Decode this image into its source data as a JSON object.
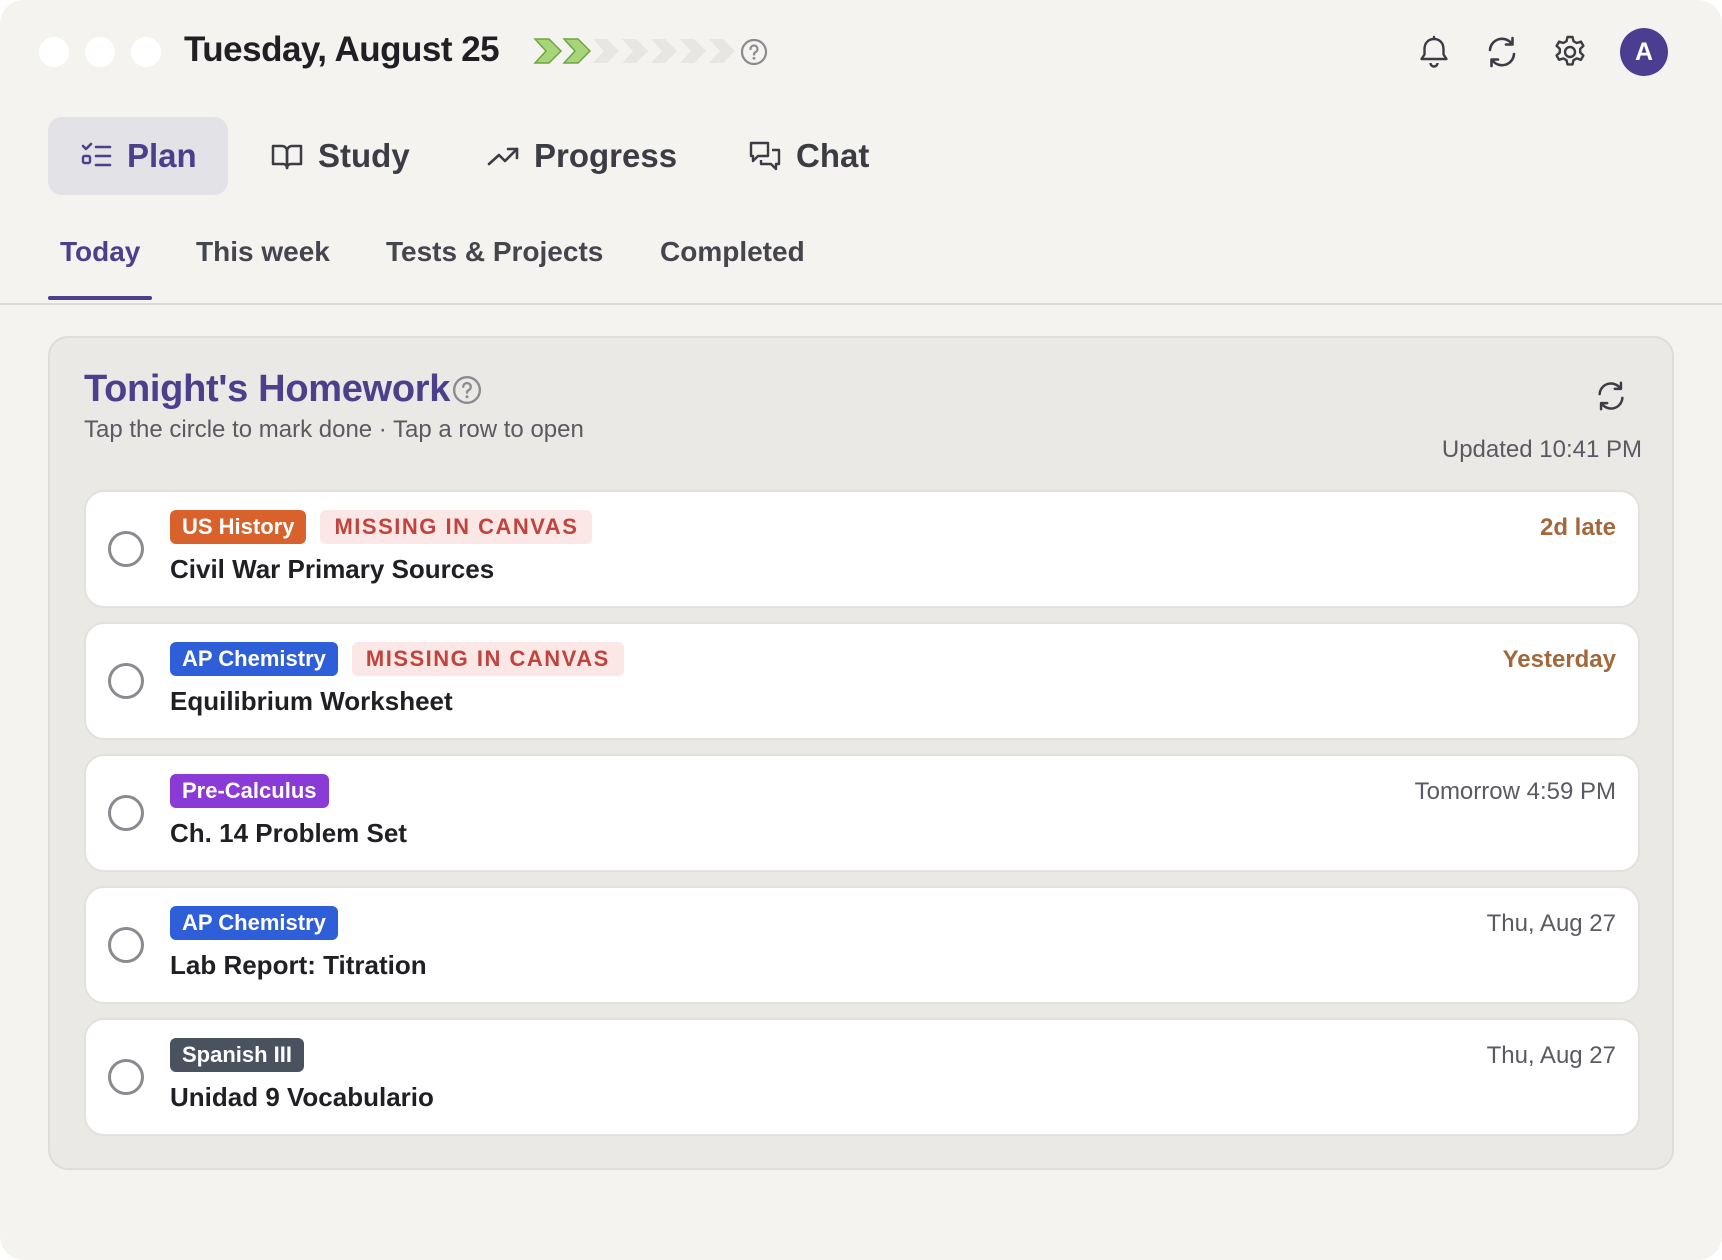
{
  "header": {
    "date": "Tuesday, August 25",
    "streak": {
      "filled": 2,
      "total": 7,
      "filled_color": "#a8d47a",
      "empty_color": "#e7e6e2"
    },
    "help_icon": "question-circle-icon",
    "icons": [
      "bell-icon",
      "refresh-icon",
      "gear-icon"
    ],
    "avatar_initial": "A",
    "avatar_color": "#4b3d8f"
  },
  "nav": {
    "items": [
      {
        "label": "Plan",
        "icon": "checklist-icon",
        "active": true
      },
      {
        "label": "Study",
        "icon": "book-icon",
        "active": false
      },
      {
        "label": "Progress",
        "icon": "trend-up-icon",
        "active": false
      },
      {
        "label": "Chat",
        "icon": "chat-bubbles-icon",
        "active": false
      }
    ]
  },
  "subtabs": {
    "items": [
      {
        "label": "Today",
        "active": true
      },
      {
        "label": "This week",
        "active": false
      },
      {
        "label": "Tests & Projects",
        "active": false
      },
      {
        "label": "Completed",
        "active": false
      }
    ]
  },
  "homework": {
    "title": "Tonight's Homework",
    "subtitle": "Tap the circle to mark done · Tap a row to open",
    "updated": "Updated 10:41 PM",
    "assignments": [
      {
        "subject": "US History",
        "subject_color": "#d9612b",
        "missing": "MISSING IN CANVAS",
        "title": "Civil War Primary Sources",
        "due": "2d late",
        "late": true
      },
      {
        "subject": "AP Chemistry",
        "subject_color": "#2f5fd8",
        "missing": "MISSING IN CANVAS",
        "title": "Equilibrium Worksheet",
        "due": "Yesterday",
        "late": true
      },
      {
        "subject": "Pre-Calculus",
        "subject_color": "#8a3ad6",
        "missing": "",
        "title": "Ch. 14 Problem Set",
        "due": "Tomorrow 4:59 PM",
        "late": false
      },
      {
        "subject": "AP Chemistry",
        "subject_color": "#2f5fd8",
        "missing": "",
        "title": "Lab Report: Titration",
        "due": "Thu, Aug 27",
        "late": false
      },
      {
        "subject": "Spanish III",
        "subject_color": "#4a5260",
        "missing": "",
        "title": "Unidad 9 Vocabulario",
        "due": "Thu, Aug 27",
        "late": false
      }
    ]
  }
}
